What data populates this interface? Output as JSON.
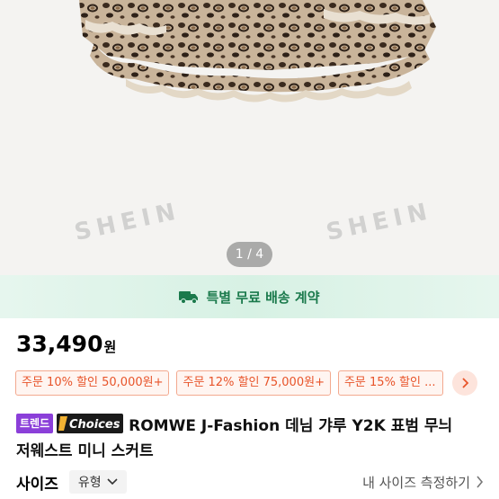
{
  "image": {
    "watermark": "SHEIN",
    "page_indicator": "1 / 4"
  },
  "shipping": {
    "text": "특별 무료 배송 계약",
    "icon": "truck-icon",
    "color": "#1b7a4c"
  },
  "price": {
    "value": "33,490",
    "unit": "원"
  },
  "coupons": [
    {
      "label": "주문 10% 할인 50,000원+"
    },
    {
      "label": "주문 12% 할인 75,000원+"
    },
    {
      "label": "주문 15% 할인 ..."
    }
  ],
  "coupon_color": "#e8542a",
  "title": {
    "badge_trend": "트렌드",
    "badge_choices": "Choices",
    "line1": "ROMWE J-Fashion 데님 갸루 Y2K 표범 무늬",
    "line2": "저웨스트 미니 스커트"
  },
  "size": {
    "label": "사이즈",
    "select_value": "유형",
    "measure_link": "내 사이즈 측정하기"
  }
}
